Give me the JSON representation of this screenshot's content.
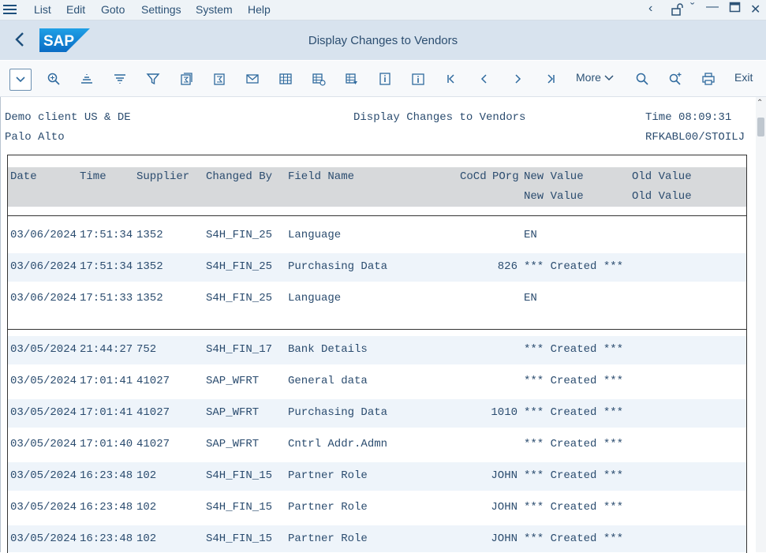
{
  "menu": {
    "items": [
      "List",
      "Edit",
      "Goto",
      "Settings",
      "System",
      "Help"
    ]
  },
  "header": {
    "title": "Display Changes to Vendors"
  },
  "toolbar": {
    "more_label": "More",
    "exit_label": "Exit"
  },
  "report": {
    "client": "Demo client US & DE",
    "title": "Display Changes to Vendors",
    "time": "Time 08:09:31",
    "city": "Palo Alto",
    "program": "RFKABL00/STOILJ"
  },
  "columns": {
    "date": "Date",
    "time": "Time",
    "supplier": "Supplier",
    "changed_by": "Changed By",
    "field_name": "Field Name",
    "cocd": "CoCd",
    "porg": "POrg",
    "new_value": "New Value",
    "old_value": "Old Value",
    "new_value2": "New Value",
    "old_value2": "Old Value"
  },
  "rows_group1": [
    {
      "date": "03/06/2024",
      "time": "17:51:34",
      "supplier": "1352",
      "changed_by": "S4H_FIN_25",
      "field": "Language",
      "org": "",
      "new": "EN"
    },
    {
      "date": "03/06/2024",
      "time": "17:51:34",
      "supplier": "1352",
      "changed_by": "S4H_FIN_25",
      "field": "Purchasing Data",
      "org": "826",
      "new": "*** Created ***"
    },
    {
      "date": "03/06/2024",
      "time": "17:51:33",
      "supplier": "1352",
      "changed_by": "S4H_FIN_25",
      "field": "Language",
      "org": "",
      "new": "EN"
    }
  ],
  "rows_group2": [
    {
      "date": "03/05/2024",
      "time": "21:44:27",
      "supplier": "752",
      "changed_by": "S4H_FIN_17",
      "field": "Bank Details",
      "org": "",
      "new": "*** Created ***"
    },
    {
      "date": "03/05/2024",
      "time": "17:01:41",
      "supplier": "41027",
      "changed_by": "SAP_WFRT",
      "field": "General data",
      "org": "",
      "new": "*** Created ***"
    },
    {
      "date": "03/05/2024",
      "time": "17:01:41",
      "supplier": "41027",
      "changed_by": "SAP_WFRT",
      "field": "Purchasing Data",
      "org": "1010",
      "new": "*** Created ***"
    },
    {
      "date": "03/05/2024",
      "time": "17:01:40",
      "supplier": "41027",
      "changed_by": "SAP_WFRT",
      "field": "Cntrl Addr.Admn",
      "org": "",
      "new": "*** Created ***"
    },
    {
      "date": "03/05/2024",
      "time": "16:23:48",
      "supplier": "102",
      "changed_by": "S4H_FIN_15",
      "field": "Partner Role",
      "org": "JOHN",
      "new": "*** Created ***"
    },
    {
      "date": "03/05/2024",
      "time": "16:23:48",
      "supplier": "102",
      "changed_by": "S4H_FIN_15",
      "field": "Partner Role",
      "org": "JOHN",
      "new": "*** Created ***"
    },
    {
      "date": "03/05/2024",
      "time": "16:23:48",
      "supplier": "102",
      "changed_by": "S4H_FIN_15",
      "field": "Partner Role",
      "org": "JOHN",
      "new": "*** Created ***"
    }
  ]
}
